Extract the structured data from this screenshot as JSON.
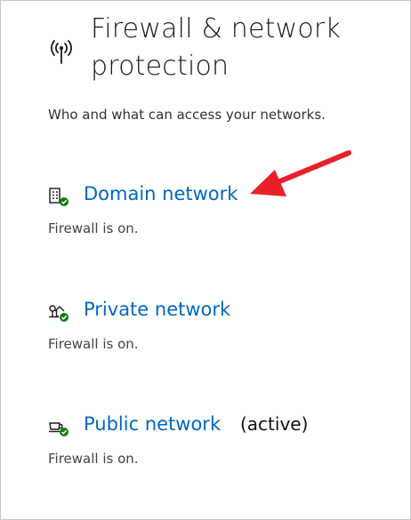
{
  "header": {
    "title": "Firewall & network protection",
    "subtitle": "Who and what can access your networks.",
    "icon": "wireless-antenna-icon"
  },
  "networks": [
    {
      "label": "Domain network",
      "status": "Firewall is on.",
      "active_label": "",
      "icon": "domain-building-icon"
    },
    {
      "label": "Private network",
      "status": "Firewall is on.",
      "active_label": "",
      "icon": "private-home-icon"
    },
    {
      "label": "Public network",
      "status": "Firewall is on.",
      "active_label": "(active)",
      "icon": "public-cafe-icon"
    }
  ],
  "colors": {
    "link": "#0067c0",
    "status_ok": "#107c10",
    "annotation_arrow": "#e8202a"
  }
}
